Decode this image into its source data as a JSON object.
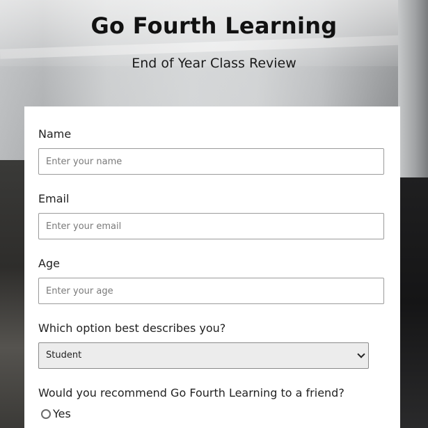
{
  "header": {
    "title": "Go Fourth Learning",
    "subtitle": "End of Year Class Review"
  },
  "form": {
    "name": {
      "label": "Name",
      "placeholder": "Enter your name",
      "value": ""
    },
    "email": {
      "label": "Email",
      "placeholder": "Enter your email",
      "value": ""
    },
    "age": {
      "label": "Age",
      "placeholder": "Enter your age",
      "value": ""
    },
    "role": {
      "label": "Which option best describes you?",
      "selected": "Student"
    },
    "recommend": {
      "label": "Would you recommend Go Fourth Learning to a friend?",
      "options": [
        {
          "label": "Yes",
          "checked": false
        }
      ]
    }
  },
  "colors": {
    "card_background": "#ffffff",
    "select_background": "#ececec",
    "text": "#222222"
  }
}
